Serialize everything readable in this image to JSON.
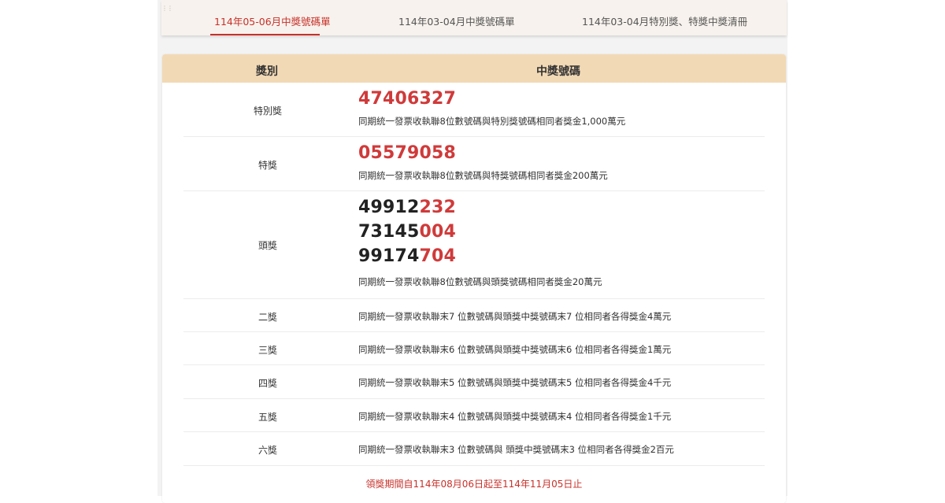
{
  "tabs": [
    {
      "label": "114年05-06月中獎號碼單",
      "active": true
    },
    {
      "label": "114年03-04月中獎號碼單",
      "active": false
    },
    {
      "label": "114年03-04月特別獎、特獎中獎清冊",
      "active": false
    }
  ],
  "table": {
    "headers": {
      "prize": "獎別",
      "numbers": "中獎號碼"
    },
    "special_prize": {
      "name": "特別獎",
      "number": "47406327",
      "desc": "同期統一發票收執聯8位數號碼與特別獎號碼相同者獎金1,000萬元"
    },
    "grand_prize": {
      "name": "特獎",
      "number": "05579058",
      "desc": "同期統一發票收執聯8位數號碼與特獎號碼相同者獎金200萬元"
    },
    "first_prize": {
      "name": "頭獎",
      "numbers": [
        {
          "prefix": "49912",
          "suffix": "232"
        },
        {
          "prefix": "73145",
          "suffix": "004"
        },
        {
          "prefix": "99174",
          "suffix": "704"
        }
      ],
      "desc": "同期統一發票收執聯8位數號碼與頭獎號碼相同者獎金20萬元"
    },
    "other_prizes": [
      {
        "name": "二獎",
        "desc": "同期統一發票收執聯末7 位數號碼與頭獎中獎號碼末7 位相同者各得獎金4萬元"
      },
      {
        "name": "三獎",
        "desc": "同期統一發票收執聯末6 位數號碼與頭獎中獎號碼末6 位相同者各得獎金1萬元"
      },
      {
        "name": "四獎",
        "desc": "同期統一發票收執聯末5 位數號碼與頭獎中獎號碼末5 位相同者各得獎金4千元"
      },
      {
        "name": "五獎",
        "desc": "同期統一發票收執聯末4 位數號碼與頭獎中獎號碼末4 位相同者各得獎金1千元"
      },
      {
        "name": "六獎",
        "desc": "同期統一發票收執聯末3 位數號碼與 頭獎中獎號碼末3 位相同者各得獎金2百元"
      }
    ],
    "claim_period": "領獎期間自114年08月06日起至114年11月05日止"
  },
  "colors": {
    "accent": "#c8312a",
    "header_bg": "#f2d9b5",
    "number_red": "#d03a3a"
  }
}
